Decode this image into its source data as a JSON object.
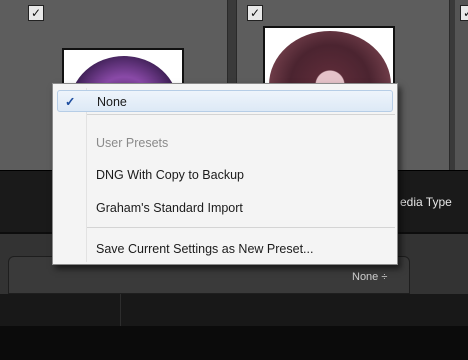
{
  "presets_menu": {
    "items": {
      "none": {
        "label": "None",
        "checked": true,
        "check_glyph": "✓"
      },
      "user_presets_header": "User Presets",
      "dng_backup": "DNG With Copy to Backup",
      "graham": "Graham's Standard Import",
      "save_new": "Save Current Settings as New Preset..."
    }
  },
  "toolbar": {
    "media_type_label": "edia Type"
  },
  "panel": {
    "preset_select_value": "None ÷"
  },
  "thumbnails": [
    {
      "checkbox": "✓",
      "icon": "disc-thumbnail-purple"
    },
    {
      "checkbox": "✓",
      "icon": "disc-thumbnail-maroon"
    },
    {
      "checkbox": "✓"
    }
  ],
  "colors": {
    "menu_bg": "#f4f4f4",
    "highlight": "#dde9f6",
    "check_blue": "#1f4fa0",
    "panel_dark": "#1a1a1a"
  }
}
